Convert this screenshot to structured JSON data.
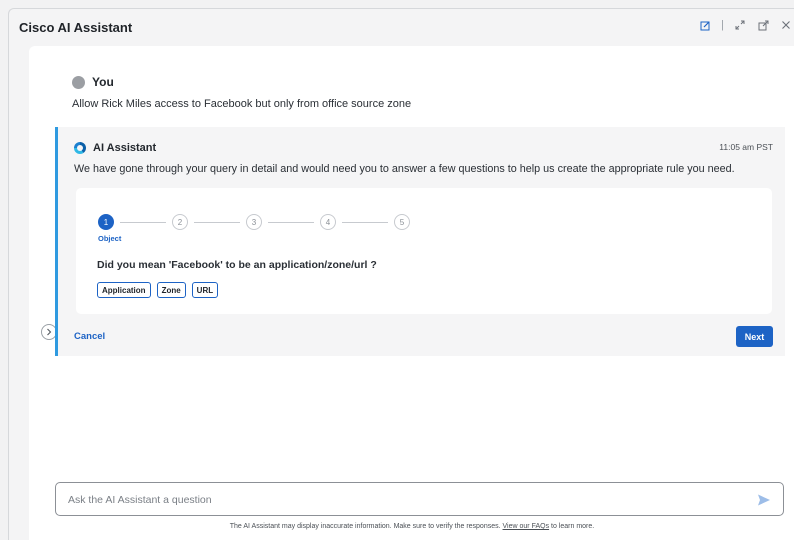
{
  "window": {
    "title": "Cisco AI Assistant",
    "actions": [
      "edit-icon",
      "expand-icon",
      "popout-icon",
      "close-icon"
    ],
    "separator": "|"
  },
  "user_message": {
    "sender": "You",
    "text": "Allow Rick Miles access to Facebook but only from office source zone"
  },
  "assistant_message": {
    "sender": "AI Assistant",
    "time": "11:05 am PST",
    "text": "We have gone through your query in detail and would need you to answer a few questions to help us create the appropriate rule you need."
  },
  "wizard": {
    "steps": [
      "1",
      "2",
      "3",
      "4",
      "5"
    ],
    "active_step": 1,
    "active_label": "Object",
    "question": "Did you mean 'Facebook' to be an application/zone/url ?",
    "options": [
      "Application",
      "Zone",
      "URL"
    ],
    "cancel_label": "Cancel",
    "next_label": "Next"
  },
  "composer": {
    "placeholder": "Ask the AI Assistant a question",
    "value": ""
  },
  "disclaimer": {
    "before": "The AI Assistant may display inaccurate information. Make sure to verify the responses.",
    "link": "View our FAQs",
    "after": "to learn more."
  },
  "colors": {
    "accent": "#1d63c5",
    "card_border": "#2f9ae0",
    "panel_bg": "#ffffff",
    "card_bg": "#f5f5f6"
  }
}
